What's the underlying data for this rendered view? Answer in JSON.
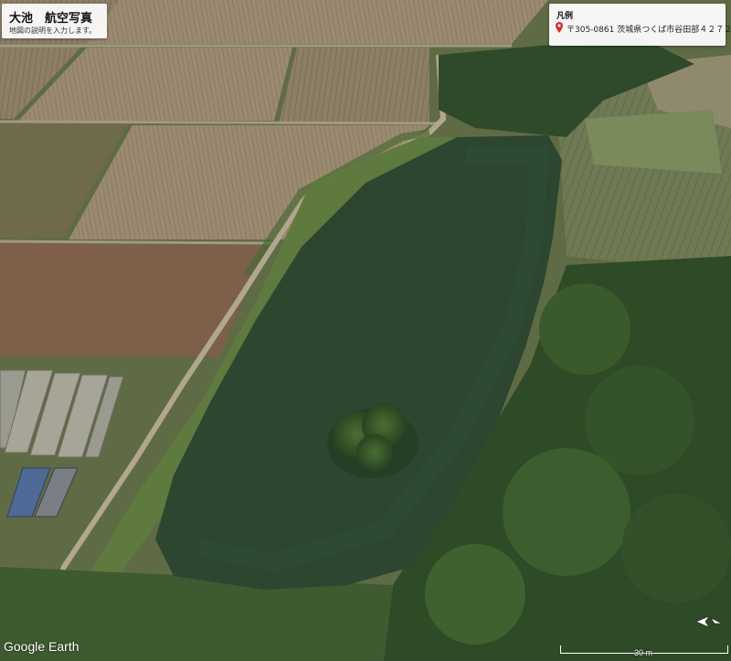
{
  "map": {
    "title": "大池　航空写真",
    "description": "地図の説明を入力します。",
    "legend": {
      "title": "凡例",
      "entries": [
        {
          "icon": "red-pin-icon",
          "label": "〒305-0861 茨城県つくば市谷田部４２７２"
        }
      ]
    },
    "attribution": {
      "google": "Google",
      "earth": "Earth"
    },
    "scale": {
      "label": "30 m"
    },
    "colors": {
      "water": "#2c4630",
      "forest": "#2f4a26",
      "field": "#8a7a62",
      "pin": "#d0342c"
    }
  }
}
